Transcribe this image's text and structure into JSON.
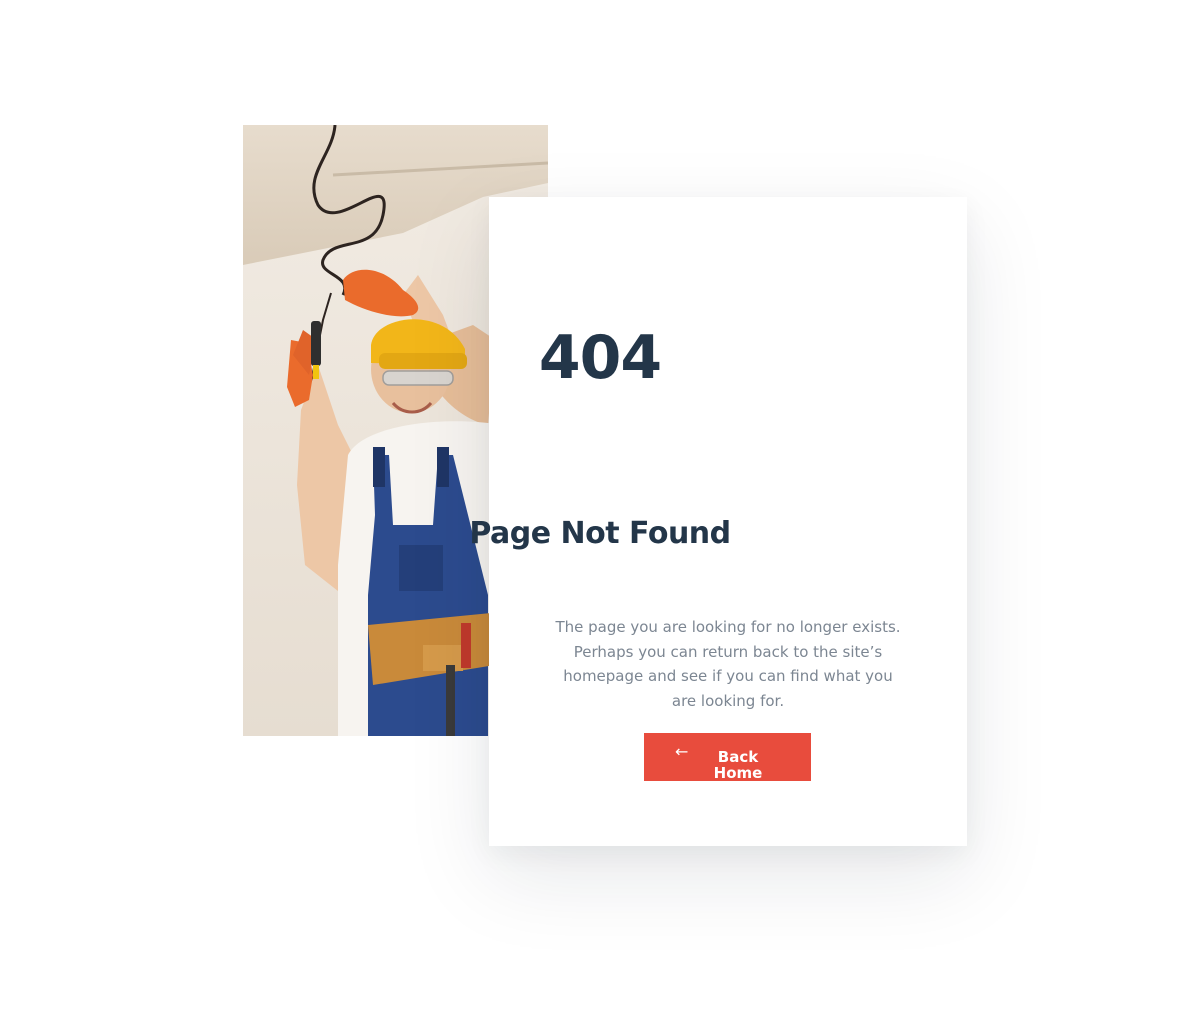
{
  "photo": {
    "icon": "electrician-photo"
  },
  "error": {
    "code": "404",
    "title": "Page Not Found",
    "message": "The page you are looking for no longer exists. Perhaps you can return back to the site’s homepage and see if you can find what you are looking for."
  },
  "back_button": {
    "icon": "arrow-left-icon",
    "arrow": "←",
    "label": "Back Home"
  },
  "colors": {
    "heading": "#233649",
    "body_text": "#7c8692",
    "button": "#e84c3d",
    "background": "#ffffff"
  }
}
